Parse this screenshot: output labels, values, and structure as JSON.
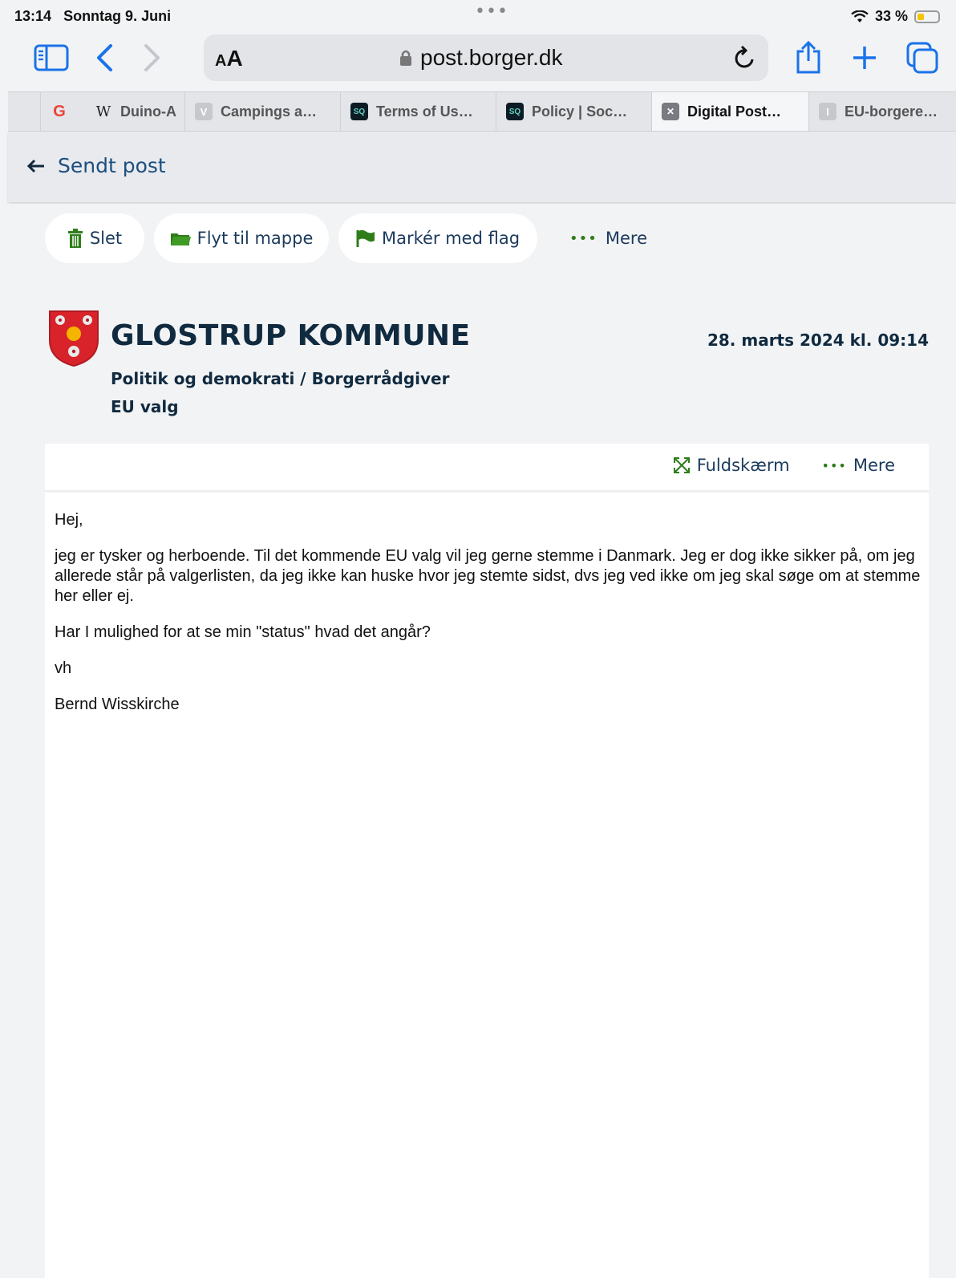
{
  "status_bar": {
    "time": "13:14",
    "date": "Sonntag 9. Juni",
    "battery": "33 %"
  },
  "browser": {
    "url": "post.borger.dk",
    "reader_label_small": "A",
    "reader_label_large": "A",
    "tabs": [
      {
        "title": "",
        "favicon": "G"
      },
      {
        "title": "Duino-A",
        "favicon": "W"
      },
      {
        "title": "Campings a…",
        "favicon": "V"
      },
      {
        "title": "Terms of Us…",
        "favicon": "SQ"
      },
      {
        "title": "Policy | Soc…",
        "favicon": "SQ"
      },
      {
        "title": "Digital Post…",
        "favicon": "✕"
      },
      {
        "title": "EU-borgere…",
        "favicon": "I"
      }
    ]
  },
  "nav": {
    "back_label": "Sendt post"
  },
  "actions": {
    "delete": "Slet",
    "move": "Flyt til mappe",
    "flag": "Markér med flag",
    "more": "Mere"
  },
  "message": {
    "sender": "GLOSTRUP KOMMUNE",
    "date": "28. marts 2024 kl. 09:14",
    "category": "Politik og demokrati / Borgerrådgiver",
    "subject": "EU valg",
    "fullscreen": "Fuldskærm",
    "more": "Mere",
    "body": [
      "Hej,",
      "jeg er tysker og herboende. Til det kommende EU valg vil jeg gerne stemme i Danmark. Jeg er dog ikke sikker på, om jeg allerede står på valgerlisten, da jeg ikke kan huske hvor jeg stemte sidst, dvs jeg ved ikke om jeg skal søge om at stemme her eller ej.",
      "Har I mulighed for at se min \"status\" hvad det angår?",
      "vh",
      "Bernd Wisskirche"
    ]
  },
  "colors": {
    "accent_blue": "#1a73e8",
    "action_green": "#2f7d1a",
    "text_dark": "#102a3f"
  }
}
